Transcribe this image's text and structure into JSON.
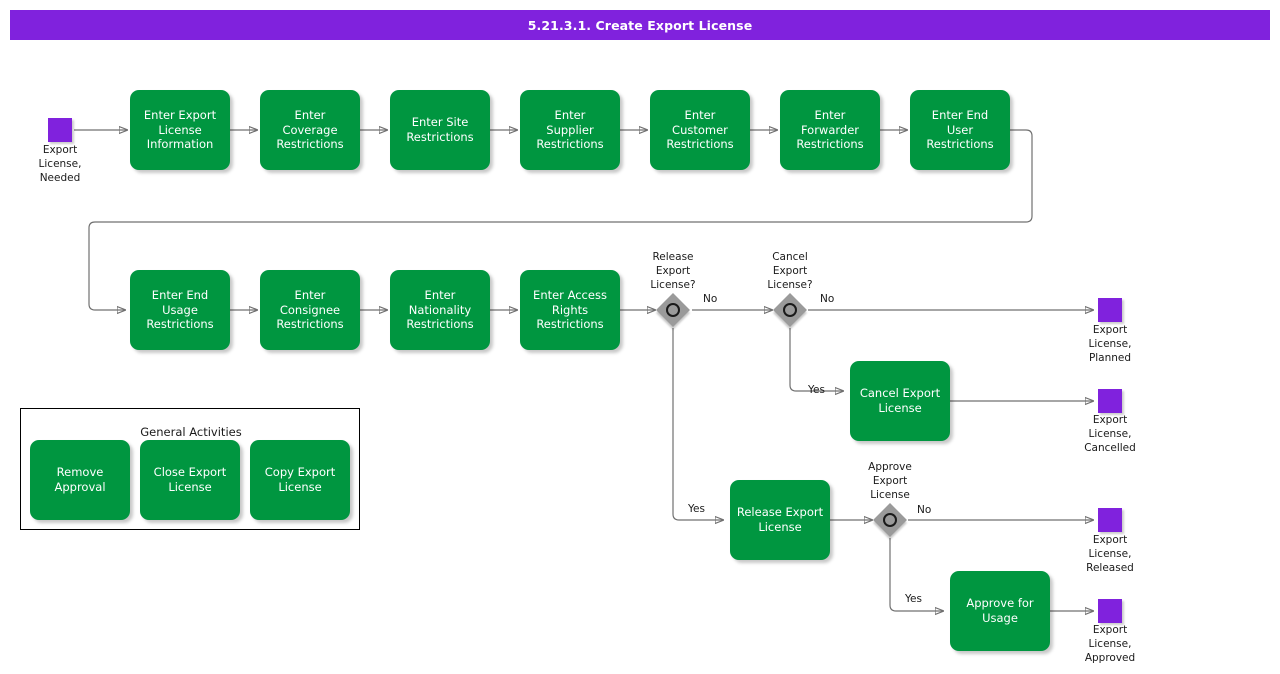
{
  "title": "5.21.3.1. Create Export License",
  "colors": {
    "accent_purple": "#8022dd",
    "task_green": "#009640",
    "gateway_gray": "#9a9a9a",
    "connector_gray": "#707070"
  },
  "start_event": {
    "name": "start-event-export-license-needed",
    "label": "Export\nLicense,\nNeeded"
  },
  "row1_tasks": [
    {
      "label": "Enter Export\nLicense\nInformation"
    },
    {
      "label": "Enter\nCoverage\nRestrictions"
    },
    {
      "label": "Enter Site\nRestrictions"
    },
    {
      "label": "Enter\nSupplier\nRestrictions"
    },
    {
      "label": "Enter\nCustomer\nRestrictions"
    },
    {
      "label": "Enter\nForwarder\nRestrictions"
    },
    {
      "label": "Enter End\nUser\nRestrictions"
    }
  ],
  "row2_tasks": [
    {
      "label": "Enter End\nUsage\nRestrictions"
    },
    {
      "label": "Enter\nConsignee\nRestrictions"
    },
    {
      "label": "Enter\nNationality\nRestrictions"
    },
    {
      "label": "Enter Access\nRights\nRestrictions"
    }
  ],
  "gateways": [
    {
      "name": "gateway-release-export-license",
      "label": "Release\nExport\nLicense?"
    },
    {
      "name": "gateway-cancel-export-license",
      "label": "Cancel\nExport\nLicense?"
    },
    {
      "name": "gateway-approve-export-license",
      "label": "Approve\nExport\nLicense"
    }
  ],
  "branch_tasks": [
    {
      "name": "task-cancel-export-license",
      "label": "Cancel Export\nLicense"
    },
    {
      "name": "task-release-export-license",
      "label": "Release Export\nLicense"
    },
    {
      "name": "task-approve-for-usage",
      "label": "Approve for\nUsage"
    }
  ],
  "end_events": [
    {
      "name": "end-event-export-license-planned",
      "label": "Export\nLicense,\nPlanned"
    },
    {
      "name": "end-event-export-license-cancelled",
      "label": "Export\nLicense,\nCancelled"
    },
    {
      "name": "end-event-export-license-released",
      "label": "Export\nLicense,\nReleased"
    },
    {
      "name": "end-event-export-license-approved",
      "label": "Export\nLicense,\nApproved"
    }
  ],
  "edge_labels": {
    "release_no": "No",
    "release_yes": "Yes",
    "cancel_no": "No",
    "cancel_yes": "Yes",
    "approve_no": "No",
    "approve_yes": "Yes"
  },
  "general_activities": {
    "title": "General Activities",
    "items": [
      {
        "label": "Remove\nApproval"
      },
      {
        "label": "Close Export\nLicense"
      },
      {
        "label": "Copy Export\nLicense"
      }
    ]
  }
}
